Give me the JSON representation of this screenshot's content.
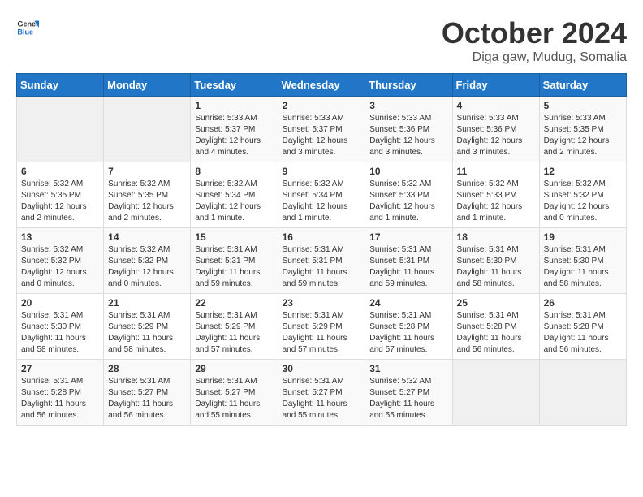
{
  "header": {
    "logo_general": "General",
    "logo_blue": "Blue",
    "month_title": "October 2024",
    "location": "Diga gaw, Mudug, Somalia"
  },
  "weekdays": [
    "Sunday",
    "Monday",
    "Tuesday",
    "Wednesday",
    "Thursday",
    "Friday",
    "Saturday"
  ],
  "weeks": [
    [
      {
        "day": "",
        "info": ""
      },
      {
        "day": "",
        "info": ""
      },
      {
        "day": "1",
        "info": "Sunrise: 5:33 AM\nSunset: 5:37 PM\nDaylight: 12 hours and 4 minutes."
      },
      {
        "day": "2",
        "info": "Sunrise: 5:33 AM\nSunset: 5:37 PM\nDaylight: 12 hours and 3 minutes."
      },
      {
        "day": "3",
        "info": "Sunrise: 5:33 AM\nSunset: 5:36 PM\nDaylight: 12 hours and 3 minutes."
      },
      {
        "day": "4",
        "info": "Sunrise: 5:33 AM\nSunset: 5:36 PM\nDaylight: 12 hours and 3 minutes."
      },
      {
        "day": "5",
        "info": "Sunrise: 5:33 AM\nSunset: 5:35 PM\nDaylight: 12 hours and 2 minutes."
      }
    ],
    [
      {
        "day": "6",
        "info": "Sunrise: 5:32 AM\nSunset: 5:35 PM\nDaylight: 12 hours and 2 minutes."
      },
      {
        "day": "7",
        "info": "Sunrise: 5:32 AM\nSunset: 5:35 PM\nDaylight: 12 hours and 2 minutes."
      },
      {
        "day": "8",
        "info": "Sunrise: 5:32 AM\nSunset: 5:34 PM\nDaylight: 12 hours and 1 minute."
      },
      {
        "day": "9",
        "info": "Sunrise: 5:32 AM\nSunset: 5:34 PM\nDaylight: 12 hours and 1 minute."
      },
      {
        "day": "10",
        "info": "Sunrise: 5:32 AM\nSunset: 5:33 PM\nDaylight: 12 hours and 1 minute."
      },
      {
        "day": "11",
        "info": "Sunrise: 5:32 AM\nSunset: 5:33 PM\nDaylight: 12 hours and 1 minute."
      },
      {
        "day": "12",
        "info": "Sunrise: 5:32 AM\nSunset: 5:32 PM\nDaylight: 12 hours and 0 minutes."
      }
    ],
    [
      {
        "day": "13",
        "info": "Sunrise: 5:32 AM\nSunset: 5:32 PM\nDaylight: 12 hours and 0 minutes."
      },
      {
        "day": "14",
        "info": "Sunrise: 5:32 AM\nSunset: 5:32 PM\nDaylight: 12 hours and 0 minutes."
      },
      {
        "day": "15",
        "info": "Sunrise: 5:31 AM\nSunset: 5:31 PM\nDaylight: 11 hours and 59 minutes."
      },
      {
        "day": "16",
        "info": "Sunrise: 5:31 AM\nSunset: 5:31 PM\nDaylight: 11 hours and 59 minutes."
      },
      {
        "day": "17",
        "info": "Sunrise: 5:31 AM\nSunset: 5:31 PM\nDaylight: 11 hours and 59 minutes."
      },
      {
        "day": "18",
        "info": "Sunrise: 5:31 AM\nSunset: 5:30 PM\nDaylight: 11 hours and 58 minutes."
      },
      {
        "day": "19",
        "info": "Sunrise: 5:31 AM\nSunset: 5:30 PM\nDaylight: 11 hours and 58 minutes."
      }
    ],
    [
      {
        "day": "20",
        "info": "Sunrise: 5:31 AM\nSunset: 5:30 PM\nDaylight: 11 hours and 58 minutes."
      },
      {
        "day": "21",
        "info": "Sunrise: 5:31 AM\nSunset: 5:29 PM\nDaylight: 11 hours and 58 minutes."
      },
      {
        "day": "22",
        "info": "Sunrise: 5:31 AM\nSunset: 5:29 PM\nDaylight: 11 hours and 57 minutes."
      },
      {
        "day": "23",
        "info": "Sunrise: 5:31 AM\nSunset: 5:29 PM\nDaylight: 11 hours and 57 minutes."
      },
      {
        "day": "24",
        "info": "Sunrise: 5:31 AM\nSunset: 5:28 PM\nDaylight: 11 hours and 57 minutes."
      },
      {
        "day": "25",
        "info": "Sunrise: 5:31 AM\nSunset: 5:28 PM\nDaylight: 11 hours and 56 minutes."
      },
      {
        "day": "26",
        "info": "Sunrise: 5:31 AM\nSunset: 5:28 PM\nDaylight: 11 hours and 56 minutes."
      }
    ],
    [
      {
        "day": "27",
        "info": "Sunrise: 5:31 AM\nSunset: 5:28 PM\nDaylight: 11 hours and 56 minutes."
      },
      {
        "day": "28",
        "info": "Sunrise: 5:31 AM\nSunset: 5:27 PM\nDaylight: 11 hours and 56 minutes."
      },
      {
        "day": "29",
        "info": "Sunrise: 5:31 AM\nSunset: 5:27 PM\nDaylight: 11 hours and 55 minutes."
      },
      {
        "day": "30",
        "info": "Sunrise: 5:31 AM\nSunset: 5:27 PM\nDaylight: 11 hours and 55 minutes."
      },
      {
        "day": "31",
        "info": "Sunrise: 5:32 AM\nSunset: 5:27 PM\nDaylight: 11 hours and 55 minutes."
      },
      {
        "day": "",
        "info": ""
      },
      {
        "day": "",
        "info": ""
      }
    ]
  ]
}
